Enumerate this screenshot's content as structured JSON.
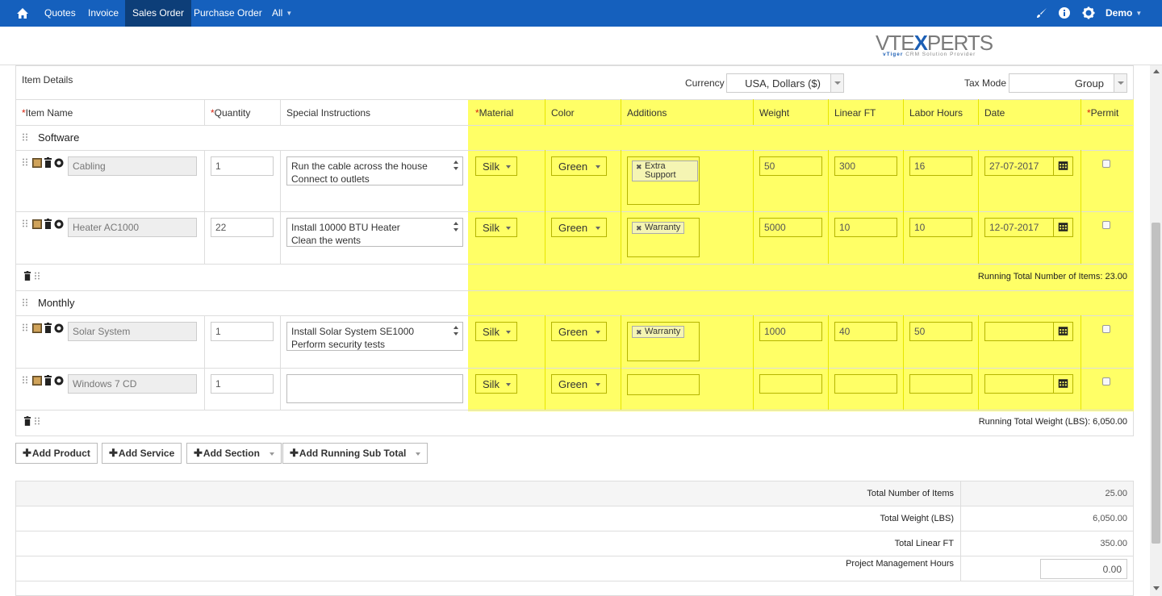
{
  "nav": {
    "quotes": "Quotes",
    "invoice": "Invoice",
    "sales_order": "Sales Order",
    "purchase_order": "Purchase Order",
    "all": "All",
    "user": "Demo"
  },
  "logo": {
    "brand_a": "VTE",
    "brand_x": "X",
    "brand_b": "PERTS",
    "sub_a": "vTiger",
    "sub_b": "CRM Solution Provider"
  },
  "item_details": {
    "title": "Item Details",
    "currency_label": "Currency",
    "currency_value": "USA, Dollars ($)",
    "tax_mode_label": "Tax Mode",
    "tax_mode_value": "Group"
  },
  "columns": {
    "item_name": "Item Name",
    "quantity": "Quantity",
    "special_instructions": "Special Instructions",
    "material": "Material",
    "color": "Color",
    "additions": "Additions",
    "weight": "Weight",
    "linear_ft": "Linear FT",
    "labor_hours": "Labor Hours",
    "date": "Date",
    "permit": "Permit",
    "required_mark": "*"
  },
  "sections": [
    {
      "title": "Software",
      "rows": [
        {
          "name": "Cabling",
          "qty": "1",
          "instr1": "Run the cable across the house",
          "instr2": "Connect to outlets",
          "material": "Silk",
          "color": "Green",
          "addition": "Extra Support",
          "weight": "50",
          "linear": "300",
          "labor": "16",
          "date": "27-07-2017"
        },
        {
          "name": "Heater AC1000",
          "qty": "22",
          "instr1": "Install 10000 BTU Heater",
          "instr2": "Clean the wents",
          "material": "Silk",
          "color": "Green",
          "addition": "Warranty",
          "weight": "5000",
          "linear": "10",
          "labor": "10",
          "date": "12-07-2017"
        }
      ],
      "summary": "Running Total Number of Items: 23.00"
    },
    {
      "title": "Monthly",
      "rows": [
        {
          "name": "Solar System",
          "qty": "1",
          "instr1": "Install Solar System SE1000",
          "instr2": "Perform security tests",
          "material": "Silk",
          "color": "Green",
          "addition": "Warranty",
          "weight": "1000",
          "linear": "40",
          "labor": "50",
          "date": ""
        },
        {
          "name": "Windows 7 CD",
          "qty": "1",
          "instr1": "",
          "instr2": "",
          "material": "Silk",
          "color": "Green",
          "addition": "",
          "weight": "",
          "linear": "",
          "labor": "",
          "date": ""
        }
      ],
      "summary": "Running Total Weight (LBS): 6,050.00"
    }
  ],
  "buttons": {
    "add_product": "Add Product",
    "add_service": "Add Service",
    "add_section": "Add Section",
    "add_running_sub_total": "Add Running Sub Total"
  },
  "totals": [
    {
      "label": "Total Number of Items",
      "value": "25.00"
    },
    {
      "label": "Total Weight (LBS)",
      "value": "6,050.00"
    },
    {
      "label": "Total Linear FT",
      "value": "350.00"
    },
    {
      "label": "Project Management Hours",
      "value": "0.00"
    }
  ],
  "colors": {
    "nav": "#1560bd",
    "nav_active": "#0d3e78",
    "highlight": "#ffff66",
    "required": "#d9230f"
  }
}
